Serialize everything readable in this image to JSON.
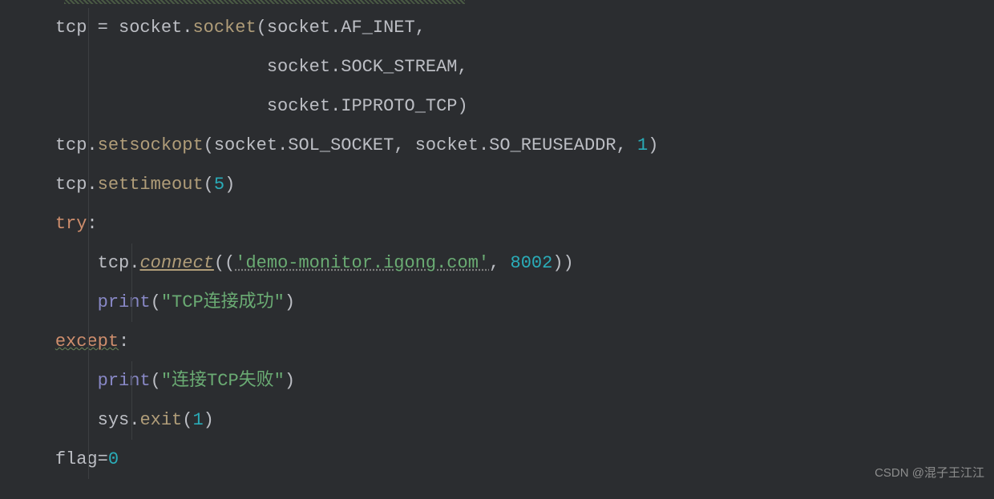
{
  "watermark": "CSDN @混子王江江",
  "code": {
    "l1": {
      "indent": "    ",
      "tcp": "tcp",
      "eq": " = ",
      "socket1": "socket",
      "dot1": ".",
      "socketfn": "socket",
      "paren1": "(",
      "socket2": "socket",
      "dot2": ".",
      "af_inet": "AF_INET",
      "comma": ","
    },
    "l2": {
      "indent": "                        ",
      "socket": "socket",
      "dot": ".",
      "sock_stream": "SOCK_STREAM",
      "comma": ","
    },
    "l3": {
      "indent": "                        ",
      "socket": "socket",
      "dot": ".",
      "ipproto": "IPPROTO_TCP",
      "paren": ")"
    },
    "l4": {
      "indent": "    ",
      "tcp": "tcp",
      "dot": ".",
      "setsockopt": "setsockopt",
      "paren1": "(",
      "socket1": "socket",
      "dot1": ".",
      "sol_socket": "SOL_SOCKET",
      "comma1": ", ",
      "socket2": "socket",
      "dot2": ".",
      "so_reuseaddr": "SO_REUSEADDR",
      "comma2": ", ",
      "one": "1",
      "paren2": ")"
    },
    "l5": {
      "indent": "    ",
      "tcp": "tcp",
      "dot": ".",
      "settimeout": "settimeout",
      "paren1": "(",
      "five": "5",
      "paren2": ")"
    },
    "l6": {
      "indent": "    ",
      "try": "try",
      "colon": ":"
    },
    "l7": {
      "indent": "        ",
      "tcp": "tcp",
      "dot": ".",
      "connect": "connect",
      "paren1": "((",
      "str": "'demo-monitor.igong.com'",
      "comma": ", ",
      "port": "8002",
      "paren2": "))"
    },
    "l8": {
      "indent": "        ",
      "print": "print",
      "paren1": "(",
      "str": "\"TCP连接成功\"",
      "paren2": ")"
    },
    "l9": {
      "indent": "    ",
      "except": "except",
      "colon": ":"
    },
    "l10": {
      "indent": "        ",
      "print": "print",
      "paren1": "(",
      "str": "\"连接TCP失败\"",
      "paren2": ")"
    },
    "l11": {
      "indent": "        ",
      "sys": "sys",
      "dot": ".",
      "exit": "exit",
      "paren1": "(",
      "one": "1",
      "paren2": ")"
    },
    "l12": {
      "indent": "    ",
      "flag": "flag",
      "eq": "=",
      "zero": "0"
    }
  }
}
